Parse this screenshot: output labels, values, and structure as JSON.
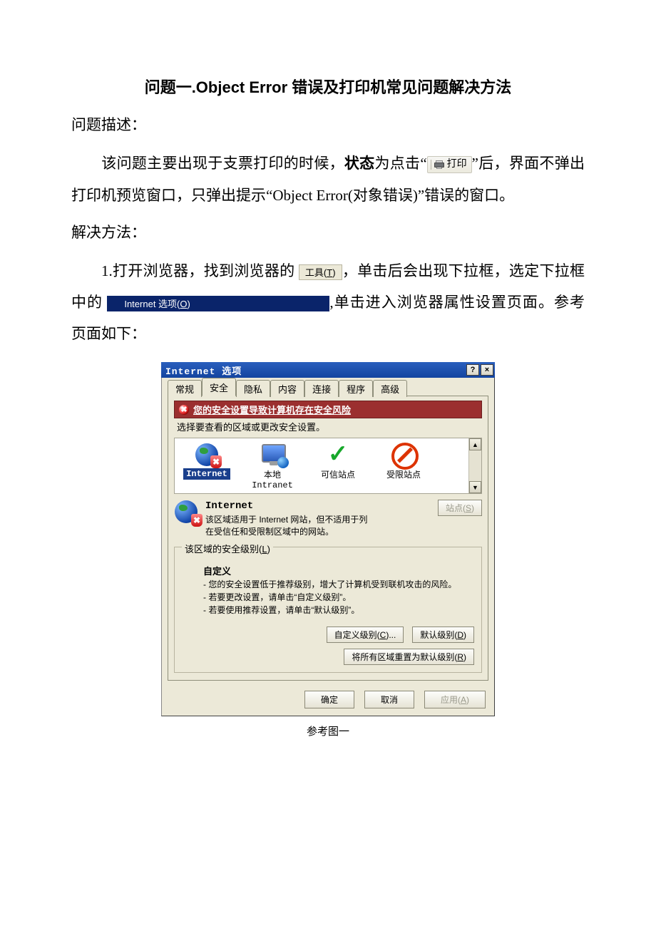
{
  "title": "问题一.Object Error 错误及打印机常见问题解决方法",
  "sect_desc": "问题描述：",
  "para1a": "该问题主要出现于支票打印的时候，",
  "para1_state": "状态",
  "para1b": "为点击“",
  "print_label": "打印",
  "para1c": "”后，界面不弹出打印机预览窗口，只弹出提示“Object Error(对象错误)”错误的窗口。",
  "sect_sol": "解决方法：",
  "para2a": "1.打开浏览器，找到浏览器的",
  "tools_text": "工具(",
  "tools_u": "T",
  "tools_text2": ")",
  "para2b": "，单击后会出现下拉框，选定下拉框中的",
  "menu_item": "Internet 选项(",
  "menu_item_u": "O",
  "menu_item2": ")",
  "para2c": ",单击进入浏览器属性设置页面。参考页面如下：",
  "dialog": {
    "title": "Internet 选项",
    "help": "?",
    "close": "×",
    "tabs": {
      "general": "常规",
      "security": "安全",
      "privacy": "隐私",
      "content": "内容",
      "connections": "连接",
      "programs": "程序",
      "advanced": "高级"
    },
    "warn": "您的安全设置导致计算机存在安全风险",
    "sub": "选择要查看的区域或更改安全设置。",
    "zones": {
      "internet": "Internet",
      "intranet": "本地",
      "intranet2": "Intranet",
      "trusted": "可信站点",
      "restricted": "受限站点"
    },
    "zone_head": "Internet",
    "zone_desc": "该区域适用于 Internet 网站，但不适用于列在受信任和受限制区域中的网站。",
    "sites_btn": "站点(",
    "sites_u": "S",
    "close_paren": ")",
    "group_label_a": "该区域的安全级别(",
    "group_u": "L",
    "level_head": "自定义",
    "level_l1": "- 您的安全设置低于推荐级别，增大了计算机受到联机攻击的风险。",
    "level_l2": "- 若要更改设置，请单击“自定义级别”。",
    "level_l3": "- 若要使用推荐设置，请单击“默认级别”。",
    "custom_btn": "自定义级别(",
    "custom_u": "C",
    "custom_suffix": ")...",
    "default_btn": "默认级别(",
    "default_u": "D",
    "reset_btn": "将所有区域重置为默认级别(",
    "reset_u": "R",
    "ok": "确定",
    "cancel": "取消",
    "apply": "应用(",
    "apply_u": "A"
  },
  "caption": "参考图一"
}
